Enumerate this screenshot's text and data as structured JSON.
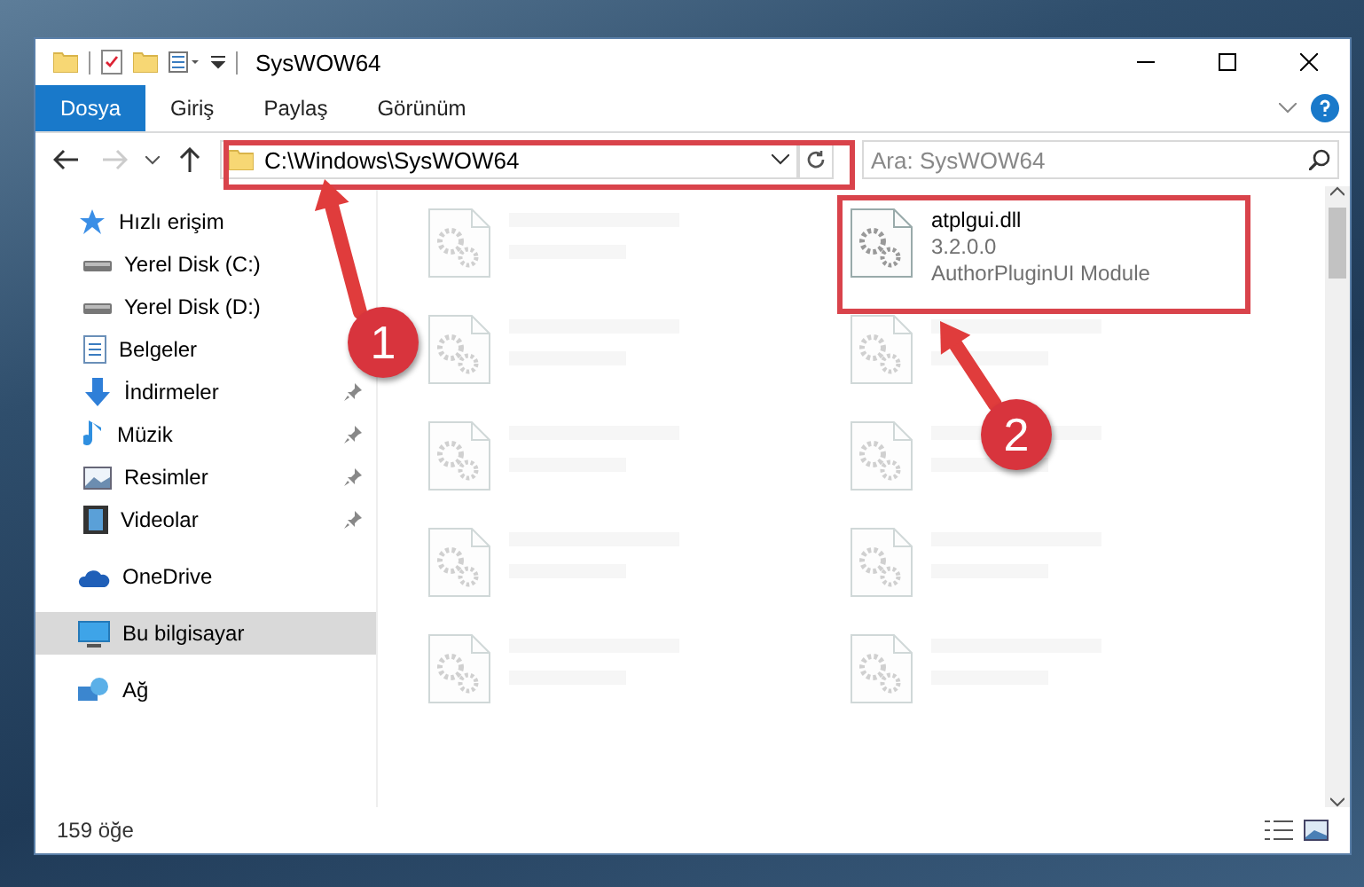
{
  "window": {
    "title": "SysWOW64"
  },
  "ribbon_tabs": [
    {
      "label": "Dosya",
      "selected": true
    },
    {
      "label": "Giriş",
      "selected": false
    },
    {
      "label": "Paylaş",
      "selected": false
    },
    {
      "label": "Görünüm",
      "selected": false
    }
  ],
  "address_bar": {
    "path": "C:\\Windows\\SysWOW64"
  },
  "search": {
    "placeholder": "Ara: SysWOW64"
  },
  "nav_pane": [
    {
      "label": "Hızlı erişim",
      "kind": "star",
      "pinned": false,
      "selected": false,
      "children": [
        {
          "label": "Yerel Disk (C:)",
          "kind": "drive",
          "pinned": false,
          "selected": false
        },
        {
          "label": "Yerel Disk (D:)",
          "kind": "drive",
          "pinned": false,
          "selected": false
        },
        {
          "label": "Belgeler",
          "kind": "docs",
          "pinned": false,
          "selected": false
        },
        {
          "label": "İndirmeler",
          "kind": "download",
          "pinned": true,
          "selected": false
        },
        {
          "label": "Müzik",
          "kind": "music",
          "pinned": true,
          "selected": false
        },
        {
          "label": "Resimler",
          "kind": "pictures",
          "pinned": true,
          "selected": false
        },
        {
          "label": "Videolar",
          "kind": "videos",
          "pinned": true,
          "selected": false
        }
      ]
    },
    {
      "label": "OneDrive",
      "kind": "cloud",
      "pinned": false,
      "selected": false
    },
    {
      "label": "Bu bilgisayar",
      "kind": "pc",
      "pinned": false,
      "selected": true
    },
    {
      "label": "Ağ",
      "kind": "network",
      "pinned": false,
      "selected": false
    }
  ],
  "files": [
    {
      "name": "atplgui.dll",
      "version": "3.2.0.0",
      "description": "AuthorPluginUI Module"
    }
  ],
  "status_bar": {
    "item_count": "159 öğe"
  },
  "annotations": [
    {
      "number": "1"
    },
    {
      "number": "2"
    }
  ]
}
